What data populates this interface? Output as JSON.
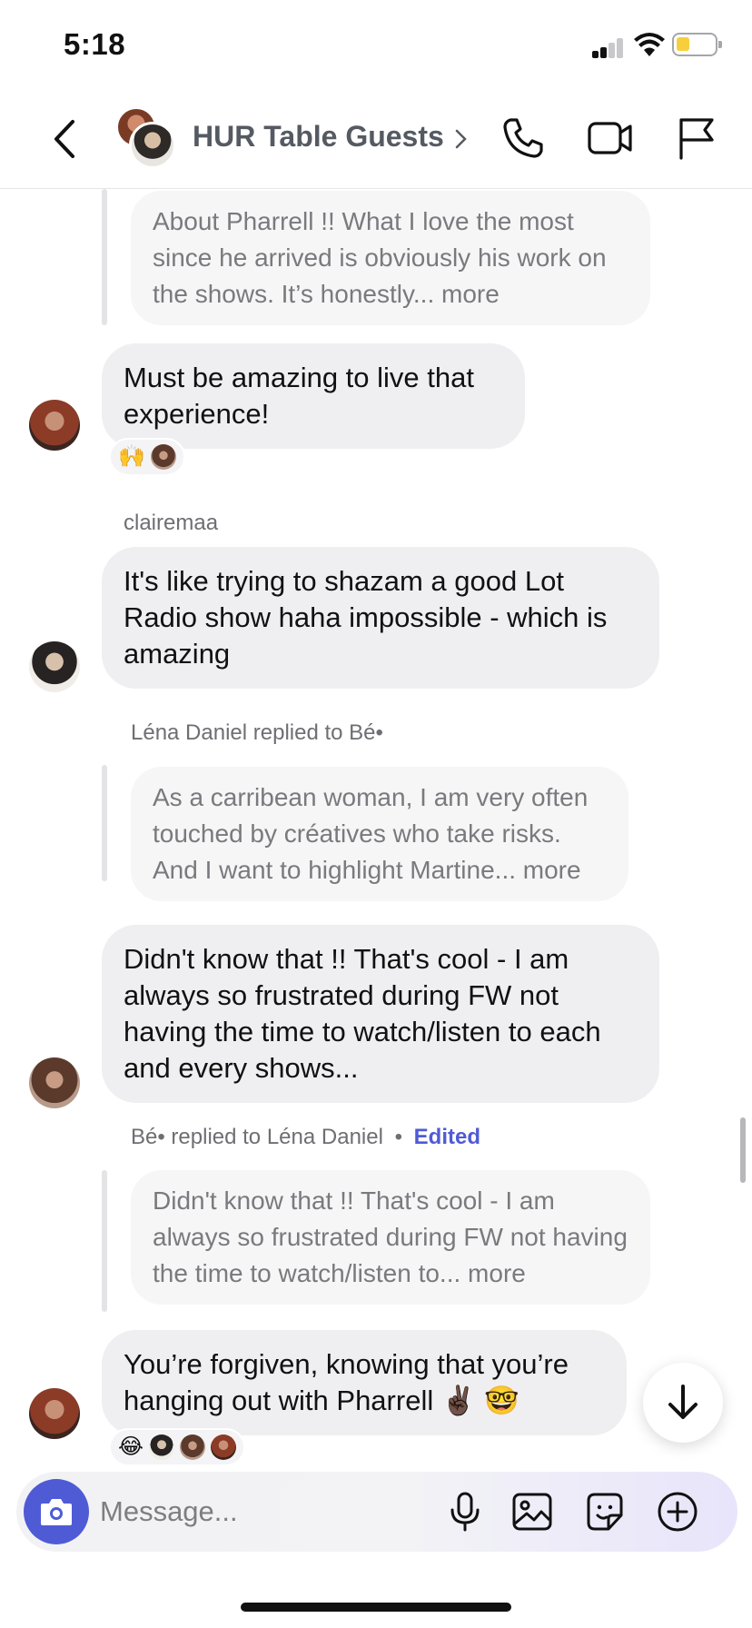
{
  "status": {
    "time": "5:18"
  },
  "header": {
    "title": "HUR Table Guests"
  },
  "messages": {
    "q1": "About Pharrell !! What I love the most since he arrived is obviously his work on the shows. It’s honestly... more",
    "m1": "Must be amazing to live that experience!",
    "m1_reaction": "🙌",
    "sender2": "clairemaa",
    "m2": "It's like trying to shazam a good Lot Radio show haha impossible - which is amazing",
    "reply3": "Léna Daniel replied to Bé•",
    "q3": "As a carribean woman, I am very often touched by créatives who take risks. And I want to highlight Martine... more",
    "m3": "Didn't know that !! That's cool - I am always so frustrated during FW not having the time to watch/listen to each and every shows...",
    "reply4": "Bé• replied to Léna Daniel",
    "reply4_dot": "•",
    "edited": "Edited",
    "q4": "Didn't know that !! That's cool - I am always so frustrated during FW not having the time to watch/listen to... more",
    "m4": "You’re forgiven, knowing that you’re hanging out with Pharrell ✌🏿 🤓",
    "m4_reaction": "😂"
  },
  "composer": {
    "placeholder": "Message..."
  },
  "colors": {
    "accent": "#4f5bd5",
    "bubble": "#efeff1",
    "quote": "#f6f6f7"
  },
  "icons": [
    "back-chevron-icon",
    "phone-icon",
    "video-icon",
    "flag-icon",
    "camera-icon",
    "microphone-icon",
    "gallery-icon",
    "sticker-icon",
    "plus-icon",
    "arrow-down-icon"
  ]
}
